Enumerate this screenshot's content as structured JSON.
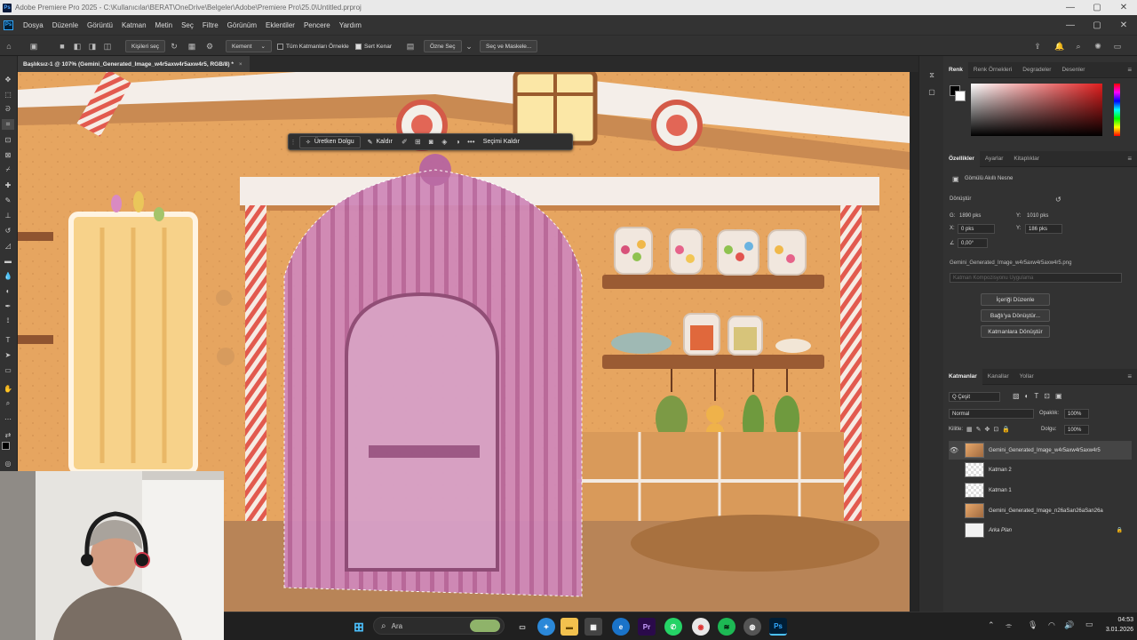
{
  "window": {
    "app_badge": "Ps",
    "title": "Adobe Premiere Pro 2025 - C:\\Kullanıcılar\\BERAT\\OneDrive\\Belgeler\\Adobe\\Premiere Pro\\25.0\\Untitled.prproj",
    "minimize": "—",
    "maximize": "▢",
    "close": "✕"
  },
  "menubar": {
    "items": [
      "Dosya",
      "Düzenle",
      "Görüntü",
      "Katman",
      "Metin",
      "Seç",
      "Filtre",
      "Görünüm",
      "Eklentiler",
      "Pencere",
      "Yardım"
    ]
  },
  "options": {
    "select_subject": "Kişileri seç",
    "mode_value": "Kement",
    "sample_all_label": "Tüm Katmanları Örnekle",
    "hard_edge_label": "Sert Kenar",
    "select_subject_btn": "Özne Seç",
    "select_mask_btn": "Seç ve Maskele..."
  },
  "document": {
    "tab_title": "Başlıksız-1 @ 107% (Gemini_Generated_Image_w4r5axw4r5axw4r5, RGB/8) *",
    "close": "×"
  },
  "contextbar": {
    "generative_fill": "Üretken Dolgu",
    "remove": "Kaldır",
    "deselect": "Seçimi Kaldır",
    "more": "•••"
  },
  "color_panel": {
    "tabs": [
      "Renk",
      "Renk Örnekleri",
      "Degradeler",
      "Desenler"
    ]
  },
  "properties_panel": {
    "tabs": [
      "Özellikler",
      "Ayarlar",
      "Kitaplıklar"
    ],
    "kind": "Gömülü Akıllı Nesne",
    "transform_label": "Dönüştür",
    "w_label": "G:",
    "w_value": "1890 pks",
    "h_label": "Y:",
    "h_value": "1010 pks",
    "x_label": "X:",
    "x_value": "0 pks",
    "y_label": "Y:",
    "y_value": "186 pks",
    "angle_value": "0,00°",
    "file_name": "Gemini_Generated_Image_w4r5axw4r5axw4r5.png",
    "comp_placeholder": "Katman Kompozisyonu Uygulama",
    "btn_edit": "İçeriği Düzenle",
    "btn_convert_linked": "Bağlı'ya Dönüştür...",
    "btn_convert_layers": "Katmanlara Dönüştür"
  },
  "layers_panel": {
    "tabs": [
      "Katmanlar",
      "Kanallar",
      "Yollar"
    ],
    "filter": "Q Çeşit",
    "blend_mode": "Normal",
    "opacity_label": "Opaklık:",
    "opacity_value": "100%",
    "lock_label": "Kilitle:",
    "fill_label": "Dolgu:",
    "fill_value": "100%",
    "layers": [
      {
        "name": "Gemini_Generated_Image_w4r5axw4r5axw4r5",
        "visible": true,
        "selected": true
      },
      {
        "name": "Katman 2",
        "visible": false,
        "selected": false
      },
      {
        "name": "Katman 1",
        "visible": false,
        "selected": false
      },
      {
        "name": "Gemini_Generated_Image_n26aSan26aSan26a",
        "visible": false,
        "selected": false
      },
      {
        "name": "Arka Plan",
        "visible": false,
        "selected": false,
        "locked": true
      }
    ]
  },
  "taskbar": {
    "search_placeholder": "Ara",
    "time": "04:53",
    "date": "3.01.2026"
  },
  "colors": {
    "accent": "#31a8ff",
    "selection_overlay": "#c97fb0",
    "wall": "#e9a961"
  }
}
